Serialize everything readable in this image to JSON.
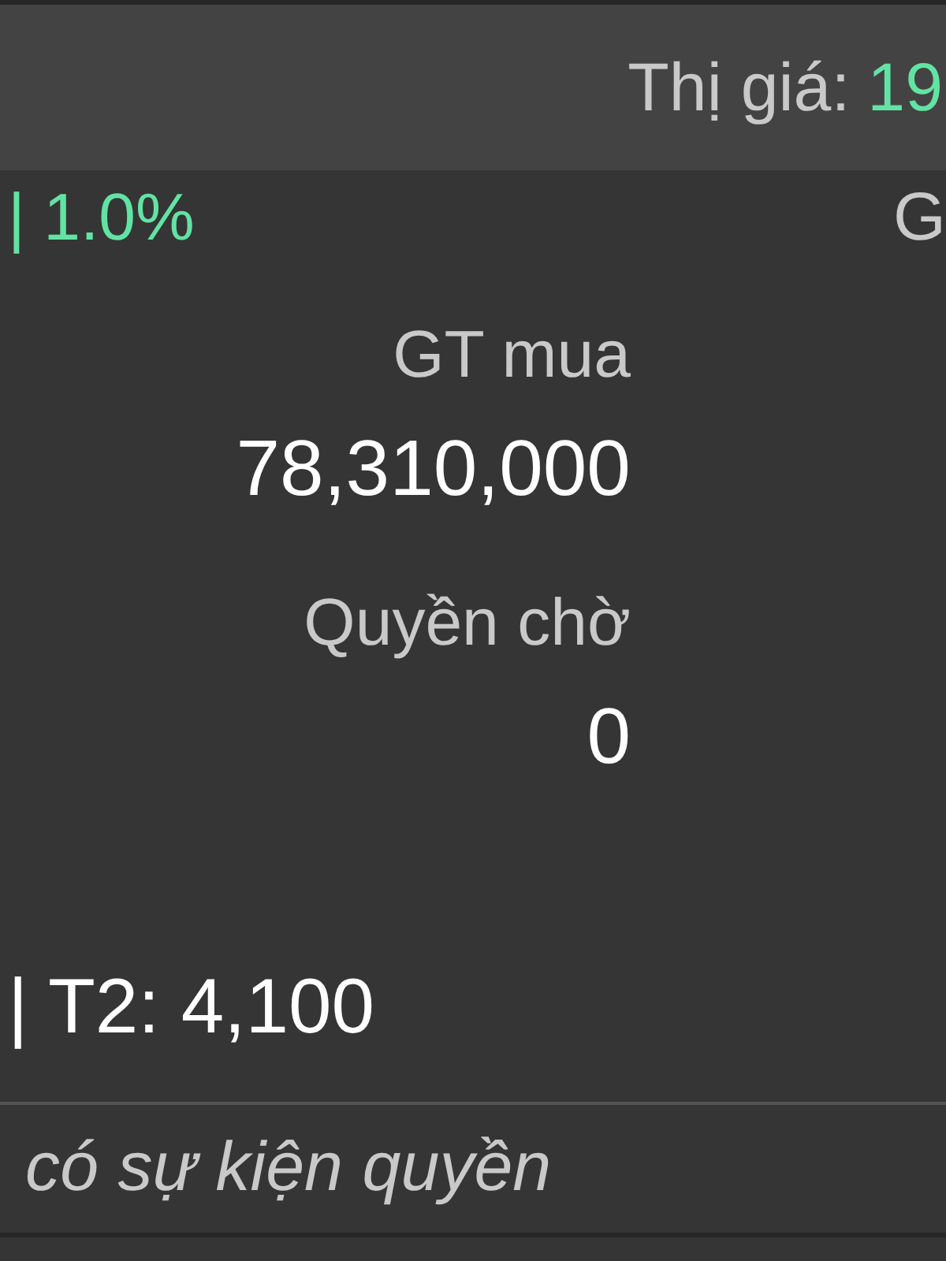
{
  "header": {
    "market_price_label": "Thị giá:",
    "market_price_value": "19"
  },
  "summary_row": {
    "change": "| 1.0%",
    "column_2_label": "G"
  },
  "stats": [
    {
      "label": "GT mua",
      "value": "78,310,000"
    },
    {
      "label": "Quyền chờ",
      "value": "0"
    }
  ],
  "settlement": "| T2: 4,100",
  "rights_note": "có sự kiện quyền"
}
